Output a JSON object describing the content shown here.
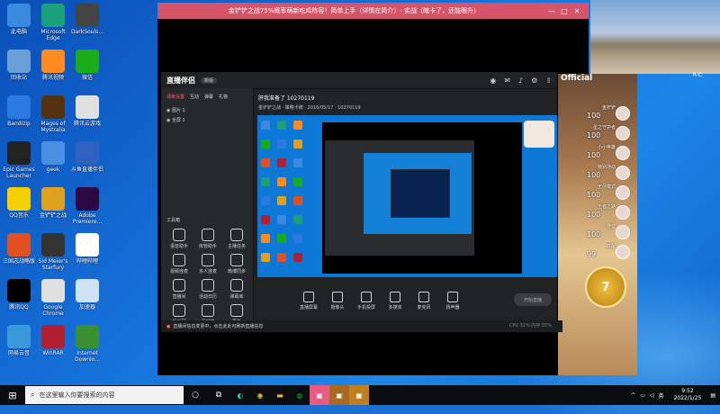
{
  "desktop_icons": [
    {
      "label": "此电脑",
      "icon": "computer-icon",
      "color": "#3a8be0"
    },
    {
      "label": "Microsoft Edge",
      "icon": "edge-icon",
      "color": "#1aa07a"
    },
    {
      "label": "DarkSouls...",
      "icon": "darksouls-icon",
      "color": "#444444"
    },
    {
      "label": "回收站",
      "icon": "recycle-bin-icon",
      "color": "#6aa0d8"
    },
    {
      "label": "腾讯视频",
      "icon": "tencent-video-icon",
      "color": "#ff8a20"
    },
    {
      "label": "微信",
      "icon": "wechat-icon",
      "color": "#1aad19"
    },
    {
      "label": "Bandizip",
      "icon": "bandizip-icon",
      "color": "#2a7ae0"
    },
    {
      "label": "Mages of Mystralia",
      "icon": "mages-icon",
      "color": "#553311"
    },
    {
      "label": "腾讯云游戏",
      "icon": "tencent-cloud-game-icon",
      "color": "#e0e0e0"
    },
    {
      "label": "Epic Games Launcher",
      "icon": "epic-icon",
      "color": "#222222"
    },
    {
      "label": "geek",
      "icon": "geek-icon",
      "color": "#4a90e2"
    },
    {
      "label": "斗鱼直播伴侣",
      "icon": "douyu-icon",
      "color": "#3060c0"
    },
    {
      "label": "QQ音乐",
      "icon": "qq-music-icon",
      "color": "#f5d000"
    },
    {
      "label": "金铲铲之战",
      "icon": "tft-icon",
      "color": "#e0a020"
    },
    {
      "label": "Adobe Premiere...",
      "icon": "premiere-icon",
      "color": "#2a0a40"
    },
    {
      "label": "三国志战略版",
      "icon": "sanguo-icon",
      "color": "#e05020"
    },
    {
      "label": "Sid Meier's Starfury",
      "icon": "starfury-icon",
      "color": "#333333"
    },
    {
      "label": "哔哩哔哩",
      "icon": "bilibili-icon",
      "color": "#ffffff"
    },
    {
      "label": "腾讯QQ",
      "icon": "qq-icon",
      "color": "#000000"
    },
    {
      "label": "Google Chrome",
      "icon": "chrome-icon",
      "color": "#e0e0e0"
    },
    {
      "label": "加速器",
      "icon": "accelerator-icon",
      "color": "#cfe3f7"
    },
    {
      "label": "网易云音",
      "icon": "cloud-music-icon",
      "color": "#3a9ad9"
    },
    {
      "label": "WinRAR",
      "icon": "winrar-icon",
      "color": "#b02030"
    },
    {
      "label": "Internet Downlo...",
      "icon": "idm-icon",
      "color": "#3a9030"
    }
  ],
  "main_window": {
    "title": "金铲铲之战75%概率萌新吃鸡阵容！简单上手（详情在简介）- 实战（瞎卡了，还能眼升）",
    "close_glyph": "✕",
    "minimize_glyph": "—",
    "maximize_glyph": "□"
  },
  "photo": {
    "label": "R-C"
  },
  "obs": {
    "app_name": "直播伴侣",
    "badge": "新版",
    "scene_tabs": [
      "场景设置",
      "互动",
      "弹幕",
      "礼物"
    ],
    "scene_items": [
      "图片 1",
      "全屏 1"
    ],
    "room_title": "肝我准备了 10270119",
    "room_sub": "金铲铲之战 · 策略卡牌 · 2016/05/17 · 10270119",
    "tools_title": "工具箱",
    "tools": [
      "语音助手",
      "房管助手",
      "主播任务",
      "视频连麦",
      "多人连麦",
      "微博同步",
      "直播间",
      "活动日历",
      "弹幕库",
      "粉丝团",
      "贡献榜",
      "更多"
    ],
    "controls": [
      "直播屏幕",
      "摄像头",
      "手机投屏",
      "多媒体",
      "麦克风",
      "扬声器"
    ],
    "start_live": "开始直播",
    "warning": "直播间信息变更中，点击此处可刷新直播信息",
    "status": "CPU 31% 内存 55%"
  },
  "overlay": {
    "official": "Official",
    "ranks": [
      {
        "label": "金铲铲",
        "score": "100"
      },
      {
        "label": "星之守护者",
        "score": "100"
      },
      {
        "label": "小小英雄",
        "score": "100"
      },
      {
        "label": "特别活动",
        "score": "100"
      },
      {
        "label": "无尽模式",
        "score": "100"
      },
      {
        "label": "王者之路",
        "score": "100"
      },
      {
        "label": "排位",
        "score": "100"
      },
      {
        "label": "匹配",
        "score": "99"
      }
    ],
    "gold": "7"
  },
  "taskbar": {
    "start_glyph": "⊞",
    "search_placeholder": "在这里输入你要搜索的内容",
    "time": "9:52",
    "date": "2022/1/25",
    "lang": "英"
  }
}
